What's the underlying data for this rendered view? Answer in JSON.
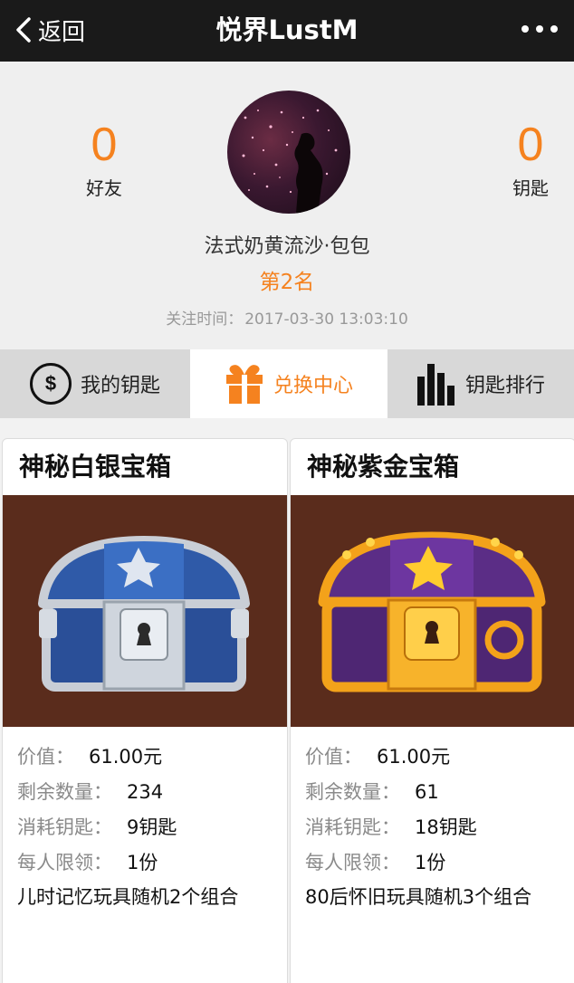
{
  "nav": {
    "back_label": "返回",
    "title": "悦界LustM"
  },
  "profile": {
    "friends": {
      "count": "0",
      "label": "好友"
    },
    "keys": {
      "count": "0",
      "label": "钥匙"
    },
    "nickname": "法式奶黄流沙·包包",
    "rank": "第2名",
    "follow_label": "关注时间：",
    "follow_time": "2017-03-30 13:03:10"
  },
  "tabs": [
    {
      "label": "我的钥匙",
      "icon": "dollar-coin-icon",
      "coin_symbol": "$"
    },
    {
      "label": "兑换中心",
      "icon": "gift-icon",
      "active": true
    },
    {
      "label": "钥匙排行",
      "icon": "bar-chart-icon"
    }
  ],
  "colors": {
    "accent": "#f5821f",
    "topbar": "#1a1a1a"
  },
  "products": [
    {
      "name": "神秘白银宝箱",
      "image": "silver-blue-treasure-chest",
      "value_label": "价值：",
      "value": "61.00元",
      "stock_label": "剩余数量：",
      "stock": "234",
      "cost_label": "消耗钥匙：",
      "cost": "9钥匙",
      "limit_label": "每人限领：",
      "limit": "1份",
      "desc": "儿时记忆玩具随机2个组合"
    },
    {
      "name": "神秘紫金宝箱",
      "image": "gold-purple-treasure-chest",
      "value_label": "价值：",
      "value": "61.00元",
      "stock_label": "剩余数量：",
      "stock": "61",
      "cost_label": "消耗钥匙：",
      "cost": "18钥匙",
      "limit_label": "每人限领：",
      "limit": "1份",
      "desc": "80后怀旧玩具随机3个组合"
    }
  ]
}
